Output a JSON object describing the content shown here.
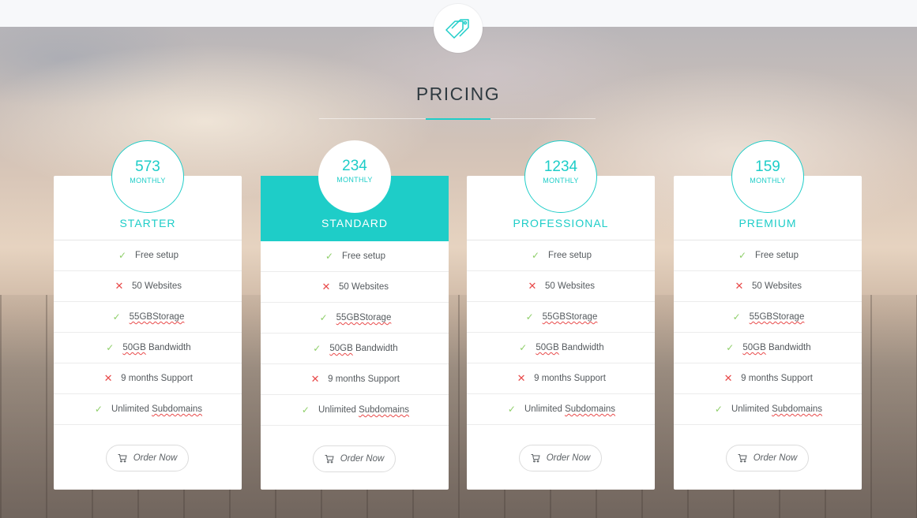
{
  "header": {
    "logo_icon": "tags-icon",
    "title": "PRICING",
    "accent_color": "#1ecdc8"
  },
  "plans": [
    {
      "name": "STARTER",
      "price": "573",
      "period": "MONTHLY",
      "featured": false,
      "features": [
        {
          "pre": "Free setup",
          "wavy": "",
          "post": "",
          "included": true
        },
        {
          "pre": "50 Websites",
          "wavy": "",
          "post": "",
          "included": false
        },
        {
          "pre": "",
          "wavy": "55GBStorage",
          "post": "",
          "included": true
        },
        {
          "pre": "",
          "wavy": "50GB",
          "post": " Bandwidth",
          "included": true
        },
        {
          "pre": "9 months Support",
          "wavy": "",
          "post": "",
          "included": false
        },
        {
          "pre": "Unlimited ",
          "wavy": "Subdomains",
          "post": "",
          "included": true
        }
      ],
      "order_label": "Order Now"
    },
    {
      "name": "STANDARD",
      "price": "234",
      "period": "MONTHLY",
      "featured": true,
      "features": [
        {
          "pre": "Free setup",
          "wavy": "",
          "post": "",
          "included": true
        },
        {
          "pre": "50 Websites",
          "wavy": "",
          "post": "",
          "included": false
        },
        {
          "pre": "",
          "wavy": "55GBStorage",
          "post": "",
          "included": true
        },
        {
          "pre": "",
          "wavy": "50GB",
          "post": " Bandwidth",
          "included": true
        },
        {
          "pre": "9 months Support",
          "wavy": "",
          "post": "",
          "included": false
        },
        {
          "pre": "Unlimited ",
          "wavy": "Subdomains",
          "post": "",
          "included": true
        }
      ],
      "order_label": "Order Now"
    },
    {
      "name": "PROFESSIONAL",
      "price": "1234",
      "period": "MONTHLY",
      "featured": false,
      "features": [
        {
          "pre": "Free setup",
          "wavy": "",
          "post": "",
          "included": true
        },
        {
          "pre": "50 Websites",
          "wavy": "",
          "post": "",
          "included": false
        },
        {
          "pre": "",
          "wavy": "55GBStorage",
          "post": "",
          "included": true
        },
        {
          "pre": "",
          "wavy": "50GB",
          "post": " Bandwidth",
          "included": true
        },
        {
          "pre": "9 months Support",
          "wavy": "",
          "post": "",
          "included": false
        },
        {
          "pre": "Unlimited ",
          "wavy": "Subdomains",
          "post": "",
          "included": true
        }
      ],
      "order_label": "Order Now"
    },
    {
      "name": "PREMIUM",
      "price": "159",
      "period": "MONTHLY",
      "featured": false,
      "features": [
        {
          "pre": "Free setup",
          "wavy": "",
          "post": "",
          "included": true
        },
        {
          "pre": "50 Websites",
          "wavy": "",
          "post": "",
          "included": false
        },
        {
          "pre": "",
          "wavy": "55GBStorage",
          "post": "",
          "included": true
        },
        {
          "pre": "",
          "wavy": "50GB",
          "post": " Bandwidth",
          "included": true
        },
        {
          "pre": "9 months Support",
          "wavy": "",
          "post": "",
          "included": false
        },
        {
          "pre": "Unlimited ",
          "wavy": "Subdomains",
          "post": "",
          "included": true
        }
      ],
      "order_label": "Order Now"
    }
  ],
  "icons": {
    "included": "check-icon",
    "excluded": "cross-icon",
    "order": "cart-icon"
  }
}
